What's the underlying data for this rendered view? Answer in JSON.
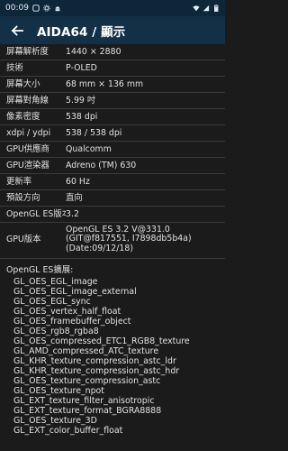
{
  "status_bar": {
    "time": "00:09"
  },
  "app_bar": {
    "title": "AIDA64  /  顯示"
  },
  "rows": [
    {
      "key": "屏幕解析度",
      "value": "1440 × 2880"
    },
    {
      "key": "技術",
      "value": "P-OLED"
    },
    {
      "key": "屏幕大小",
      "value": "68 mm × 136 mm"
    },
    {
      "key": "屏幕對角線",
      "value": "5.99 吋"
    },
    {
      "key": "像素密度",
      "value": "538 dpi"
    },
    {
      "key": "xdpi / ydpi",
      "value": "538 / 538 dpi"
    },
    {
      "key": "GPU供應商",
      "value": "Qualcomm"
    },
    {
      "key": "GPU渲染器",
      "value": "Adreno (TM) 630"
    },
    {
      "key": "更新率",
      "value": "60 Hz"
    },
    {
      "key": "預設方向",
      "value": "直向"
    },
    {
      "key": "OpenGL ES版本",
      "value": "3.2"
    }
  ],
  "gpu_version": {
    "key": "GPU版本",
    "value": "OpenGL ES 3.2 V@331.0\n(GIT@f817551, I7898db5b4a)\n(Date:09/12/18)"
  },
  "extensions": {
    "header": "OpenGL ES擴展:",
    "items": [
      "GL_OES_EGL_image",
      "GL_OES_EGL_image_external",
      "GL_OES_EGL_sync",
      "GL_OES_vertex_half_float",
      "GL_OES_framebuffer_object",
      "GL_OES_rgb8_rgba8",
      "GL_OES_compressed_ETC1_RGB8_texture",
      "GL_AMD_compressed_ATC_texture",
      "GL_KHR_texture_compression_astc_ldr",
      "GL_KHR_texture_compression_astc_hdr",
      "GL_OES_texture_compression_astc",
      "GL_OES_texture_npot",
      "GL_EXT_texture_filter_anisotropic",
      "GL_EXT_texture_format_BGRA8888",
      "GL_OES_texture_3D",
      "GL_EXT_color_buffer_float"
    ]
  }
}
